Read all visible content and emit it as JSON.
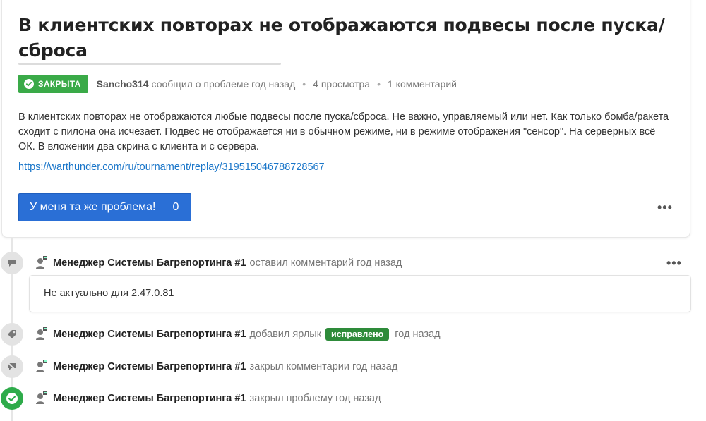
{
  "issue": {
    "title": "В клиентских повторах не отображаются подвесы после пуска/сброса",
    "status": "ЗАКРЫТА",
    "author": "Sancho314",
    "reported": "сообщил о проблеме год назад",
    "views": "4 просмотра",
    "comments_count": "1 комментарий",
    "description": "В клиентских повторах не отображаются любые подвесы после пуска/сброса. Не важно, управляемый или нет. Как только бомба/ракета сходит с пилона она исчезает. Подвес не отображается ни в обычном режиме, ни в режиме отображения \"сенсор\". На серверных всё ОК. В вложении два скрина с клиента и с сервера.",
    "link": "https://warthunder.com/ru/tournament/replay/319515046788728567",
    "me_too_label": "У меня та же проблема!",
    "me_too_count": "0",
    "more": "•••"
  },
  "timeline": [
    {
      "icon": "speech-bubble-icon",
      "who": "Менеджер Системы Багрепортинга #1",
      "action": "оставил комментарий год назад",
      "comment": "Не актуально для 2.47.0.81",
      "more": "•••"
    },
    {
      "icon": "tag-icon",
      "who": "Менеджер Системы Багрепортинга #1",
      "action": "добавил ярлык",
      "tag": "исправлено",
      "time": "год назад"
    },
    {
      "icon": "comments-off-icon",
      "who": "Менеджер Системы Багрепортинга #1",
      "action": "закрыл комментарии год назад"
    },
    {
      "icon": "check-circle-icon",
      "who": "Менеджер Системы Багрепортинга #1",
      "action": "закрыл проблему год назад"
    }
  ],
  "colors": {
    "status_green": "#3aaa48",
    "tag_green": "#2e8b3a",
    "button_blue": "#2a6fd6",
    "link_blue": "#1a76c9"
  }
}
